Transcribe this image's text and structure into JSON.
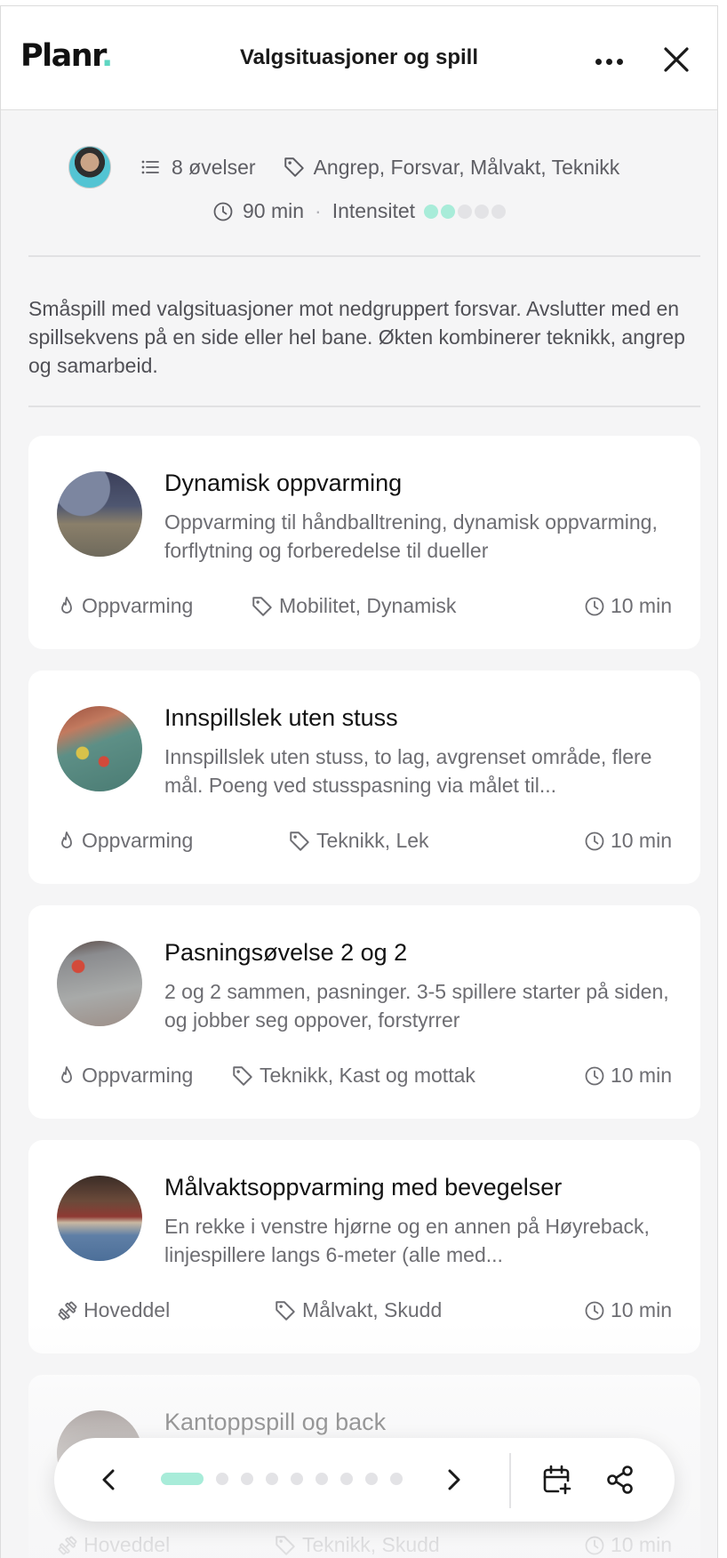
{
  "header": {
    "logo": "Planr",
    "logo_dot": ".",
    "title": "Valgsituasjoner og spill"
  },
  "meta": {
    "exercises": "8 øvelser",
    "tags": "Angrep, Forsvar, Målvakt, Teknikk",
    "duration": "90 min",
    "separator": "·",
    "intensity_label": "Intensitet",
    "intensity_level": 2,
    "intensity_max": 5
  },
  "description": "Småspill med valgsituasjoner mot nedgruppert forsvar. Avslutter med en spillsekvens på en side eller hel bane. Økten kombinerer teknikk, angrep og samarbeid.",
  "exercises": [
    {
      "name": "Dynamisk oppvarming",
      "text": "Oppvarming til håndballtrening, dynamisk oppvarming, forflytning og forberedelse til dueller",
      "category": "Oppvarming",
      "category_icon": "flame-icon",
      "tags": "Mobilitet, Dynamisk",
      "duration": "10 min"
    },
    {
      "name": "Innspillslek uten stuss",
      "text": "Innspillslek uten stuss, to lag, avgrenset område, flere mål. Poeng ved stusspasning via målet til...",
      "category": "Oppvarming",
      "category_icon": "flame-icon",
      "tags": "Teknikk, Lek",
      "duration": "10 min"
    },
    {
      "name": "Pasningsøvelse 2 og 2",
      "text": "2 og 2 sammen, pasninger. 3-5 spillere starter på siden, og jobber seg oppover, forstyrrer",
      "category": "Oppvarming",
      "category_icon": "flame-icon",
      "tags": "Teknikk, Kast og mottak",
      "duration": "10 min"
    },
    {
      "name": "Målvaktsoppvarming med bevegelser",
      "text": "En rekke i venstre hjørne og en annen på Høyreback, linjespillere langs 6-meter (alle med...",
      "category": "Hoveddel",
      "category_icon": "dumbbell-icon",
      "tags": "Målvakt, Skudd",
      "duration": "10 min"
    },
    {
      "name": "Kantoppspill og back",
      "text": "",
      "category": "Hoveddel",
      "category_icon": "dumbbell-icon",
      "tags": "Teknikk, Skudd",
      "duration": "10 min"
    }
  ],
  "toolbar": {
    "pages": 10,
    "current_page": 1
  },
  "colors": {
    "accent": "#a8ecd9",
    "logo_dot": "#5fd6c2"
  }
}
